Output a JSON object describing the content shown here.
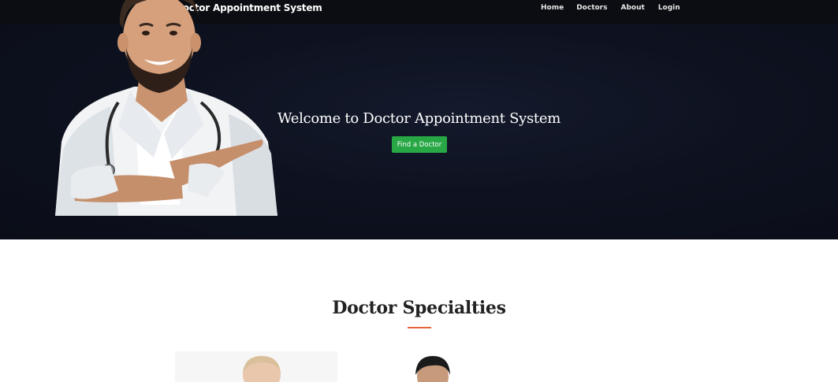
{
  "nav": {
    "brand": "Doctor Appointment System",
    "links": [
      "Home",
      "Doctors",
      "About",
      "Login"
    ]
  },
  "hero": {
    "title": "Welcome to Doctor Appointment System",
    "button": "Find a Doctor"
  },
  "specialties": {
    "title": "Doctor Specialties"
  },
  "colors": {
    "navbar": "#0b0d12",
    "hero_bg": "#0e1220",
    "button": "#28a745",
    "accent": "#e8623c"
  }
}
